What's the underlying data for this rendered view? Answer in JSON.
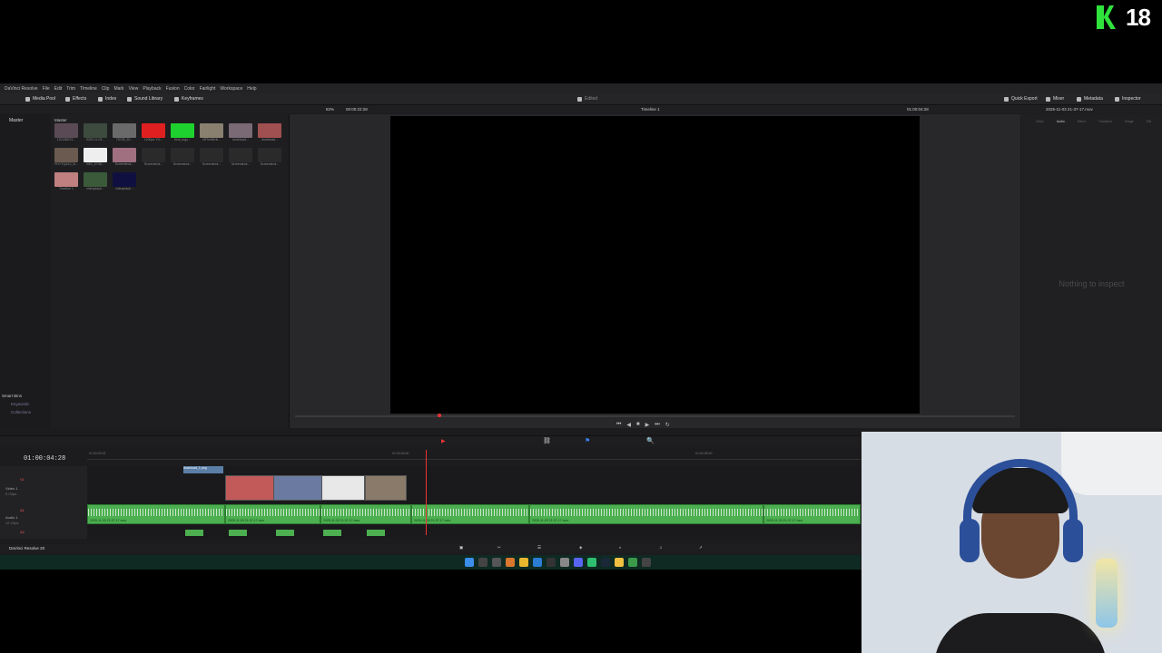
{
  "overlay": {
    "channel_number": "18"
  },
  "menu": [
    "DaVinci Resolve",
    "File",
    "Edit",
    "Trim",
    "Timeline",
    "Clip",
    "Mark",
    "View",
    "Playback",
    "Fusion",
    "Color",
    "Fairlight",
    "Workspace",
    "Help"
  ],
  "toolbar": {
    "media_pool": "Media Pool",
    "effects": "Effects",
    "index": "Index",
    "sound_library": "Sound Library",
    "keyframes": "Keyframes",
    "project_name": "Edited",
    "quick_export": "Quick Export",
    "mixer": "Mixer",
    "metadata": "Metadata",
    "inspector": "Inspector"
  },
  "subbar": {
    "zoom": "82%",
    "source_timecode": "00:00:22:28",
    "timeline_name": "Timeline 1",
    "record_timecode": "01:00:04:28",
    "inspector_clip": "2025-11-03 21-37-17.mov"
  },
  "pool": {
    "bins_label": "Master",
    "header_label": "Master",
    "smart_bins": "Smart Bins",
    "smart_items": [
      "Keywords",
      "Collections"
    ],
    "thumbs": [
      {
        "caption": "120186572...",
        "color": "#5a4a55"
      },
      {
        "caption": "2025-11-03...",
        "color": "#3d4a3e"
      },
      {
        "caption": "75728_20...",
        "color": "#6a6a6a"
      },
      {
        "caption": "1200px-YO...",
        "color": "#e02020"
      },
      {
        "caption": "Kick_logo...",
        "color": "#1fd12e"
      },
      {
        "caption": "sRTwrBrhll...",
        "color": "#8a8070"
      },
      {
        "caption": "download...",
        "color": "#7a6a75"
      },
      {
        "caption": "download...",
        "color": "#a05050"
      },
      {
        "caption": "FDYTQAZ2_B...",
        "color": "#6a5a50"
      },
      {
        "caption": "IMG_0748...",
        "color": "#eeeeee"
      },
      {
        "caption": "Screenshot...",
        "color": "#a07080"
      },
      {
        "caption": "Screenshot...",
        "color": "#2a2a2a"
      },
      {
        "caption": "Screenshot...",
        "color": "#2a2a2a"
      },
      {
        "caption": "Screenshot...",
        "color": "#2a2a2a"
      },
      {
        "caption": "Screenshot...",
        "color": "#2a2a2a"
      },
      {
        "caption": "Screenshot...",
        "color": "#2a2a2a"
      },
      {
        "caption": "Timeline 1",
        "color": "#c08080"
      },
      {
        "caption": "videoplayb...",
        "color": "#3a5a3a"
      },
      {
        "caption": "videoplayb...",
        "color": "#101040"
      }
    ]
  },
  "inspector": {
    "empty_text": "Nothing to inspect",
    "tabs": [
      "Video",
      "Audio",
      "Effect",
      "Transition",
      "Image",
      "File"
    ]
  },
  "timeline": {
    "timecode": "01:00:04:28",
    "ruler": [
      "01:00:00:02",
      "01:00:04:00",
      "01:00:08:00"
    ],
    "v1_label": "V1",
    "v1_name": "Video 1",
    "v1_count": "5 Clips",
    "a1_label": "A1",
    "a1_name": "Audio 1",
    "a1_count": "12 Clips",
    "a2_label": "A2",
    "title_clip": "download_1.png",
    "audio_clips": [
      {
        "name": "2025-11-03 21-37-17.mov"
      },
      {
        "name": "2025-11-03 21-37-17.mov"
      },
      {
        "name": "2025-11-03 21-37-17.mov"
      },
      {
        "name": "2025-11-03 21-37-17.mov"
      },
      {
        "name": "2025-11-03 21-37-17.mov"
      },
      {
        "name": "2025-11-03 21-37-17.mov"
      },
      {
        "name": "2025-11-03 21-37-17.mov"
      }
    ]
  },
  "status": {
    "app_name": "DaVinci Resolve 20"
  }
}
